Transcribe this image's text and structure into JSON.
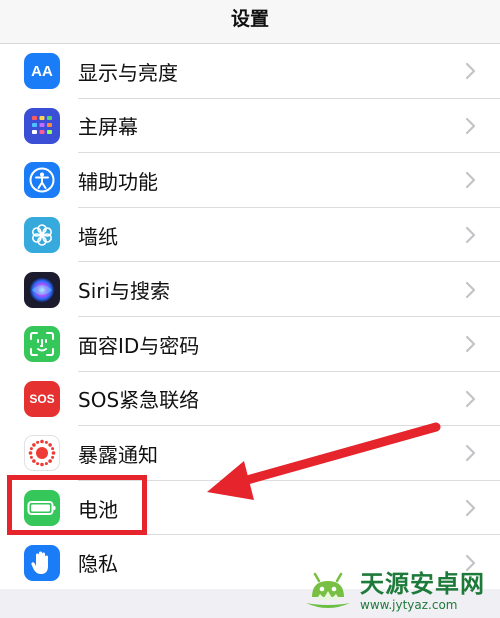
{
  "header": {
    "title": "设置"
  },
  "rows": [
    {
      "id": "display",
      "label": "显示与亮度",
      "icon": "display-brightness-icon",
      "color": "#1a7cf6"
    },
    {
      "id": "home",
      "label": "主屏幕",
      "icon": "home-screen-icon",
      "color": "#3b4fd6"
    },
    {
      "id": "accessibility",
      "label": "辅助功能",
      "icon": "accessibility-icon",
      "color": "#1a7cf6"
    },
    {
      "id": "wallpaper",
      "label": "墙纸",
      "icon": "wallpaper-icon",
      "color": "#36aadc"
    },
    {
      "id": "siri",
      "label": "Siri与搜索",
      "icon": "siri-icon",
      "color": "#1c1c2e"
    },
    {
      "id": "faceid",
      "label": "面容ID与密码",
      "icon": "face-id-icon",
      "color": "#35c759"
    },
    {
      "id": "sos",
      "label": "SOS紧急联络",
      "icon": "sos-icon",
      "color": "#e5312f"
    },
    {
      "id": "exposure",
      "label": "暴露通知",
      "icon": "exposure-notification-icon",
      "color": "#ffffff"
    },
    {
      "id": "battery",
      "label": "电池",
      "icon": "battery-icon",
      "color": "#35c759"
    },
    {
      "id": "privacy",
      "label": "隐私",
      "icon": "privacy-hand-icon",
      "color": "#1a7cf6"
    }
  ],
  "icon_text": {
    "display": "AA",
    "sos": "SOS"
  },
  "annotation": {
    "highlight_color": "#e5242c"
  },
  "watermark": {
    "title": "天源安卓网",
    "url": "www.jytyaz.com"
  }
}
